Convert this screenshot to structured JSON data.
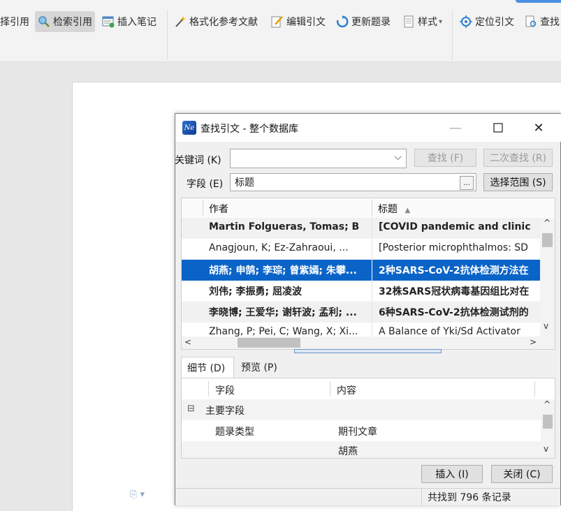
{
  "ribbon": {
    "items": [
      {
        "label": "择引用"
      },
      {
        "label": "检索引用"
      },
      {
        "label": "插入笔记"
      },
      {
        "label": "格式化参考文献"
      },
      {
        "label": "编辑引文"
      },
      {
        "label": "更新题录"
      },
      {
        "label": "样式"
      },
      {
        "label": "定位引文"
      },
      {
        "label": "查找"
      }
    ],
    "style_dropdown_arrow": "▾"
  },
  "dialog": {
    "title": "查找引文 - 整个数据库",
    "app_icon_text": "Ne",
    "keyword_label": "关键词 (K)",
    "keyword_value": "",
    "field_label": "字段 (E)",
    "field_value": "标题",
    "field_browse": "...",
    "find_button": "查找 (F)",
    "refind_button": "二次查找 (R)",
    "range_button": "选择范围 (S)",
    "results": {
      "columns": [
        "作者",
        "标题"
      ],
      "sort_indicator": "▲",
      "rows": [
        {
          "author": "Martin Folgueras, Tomas; B",
          "title": "[COVID pandemic and clinic"
        },
        {
          "author": "Anagjoun, K; Ez-Zahraoui, ...",
          "title": "[Posterior microphthalmos: SD"
        },
        {
          "author": "胡燕; 申鹄; 李琮; 曾紫嫣; 朱攀...",
          "title": "2种SARS-CoV-2抗体检测方法在"
        },
        {
          "author": "刘伟; 李振勇; 屈凌波",
          "title": "32株SARS冠状病毒基因组比对在"
        },
        {
          "author": "李晓博; 王爱华; 谢轩波; 孟利; ...",
          "title": "6种SARS-CoV-2抗体检测试剂的"
        },
        {
          "author": "Zhang, P; Pei, C; Wang, X; Xi...",
          "title": "A Balance of Yki/Sd Activator"
        }
      ]
    },
    "tabs": [
      "细节 (D)",
      "预览 (P)"
    ],
    "detail": {
      "columns": [
        "字段",
        "内容"
      ],
      "group_toggle": "⊟",
      "group_label": "主要字段",
      "rows": [
        {
          "field": "题录类型",
          "value": "期刊文章"
        },
        {
          "field": "",
          "value": "胡燕"
        }
      ]
    },
    "insert_button": "插入 (I)",
    "close_button": "关闭 (C)",
    "status_text": "共找到 796 条记录"
  },
  "icons": {
    "win_min": "—",
    "win_max": "☐",
    "win_close": "✕",
    "scroll_up": "^",
    "scroll_down": "v",
    "scroll_left": "<",
    "scroll_right": ">",
    "dropdown": "⌵"
  },
  "doc_mark": "⎘ ▾"
}
